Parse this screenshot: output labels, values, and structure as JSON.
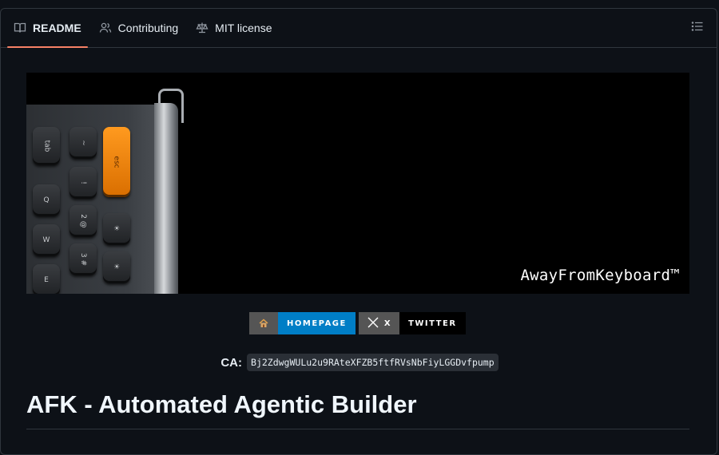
{
  "tabs": [
    {
      "label": "README",
      "icon": "book-icon",
      "active": true
    },
    {
      "label": "Contributing",
      "icon": "people-icon"
    },
    {
      "label": "MIT license",
      "icon": "law-scale-icon"
    }
  ],
  "outline_icon": "list-unordered-icon",
  "banner": {
    "wordmark": "AwayFromKeyboard™",
    "key_labels": [
      "tab",
      "~",
      "esc",
      "Q",
      "!",
      "2 @",
      "W",
      "3 #",
      "E"
    ]
  },
  "badges": {
    "homepage": {
      "icon": "house-emoji-icon",
      "label": "HOMEPAGE",
      "color": "#007ec6"
    },
    "twitter": {
      "icon": "x-logo-icon",
      "left_label": "X",
      "label": "TWITTER",
      "color": "#000000"
    }
  },
  "ca": {
    "label": "CA:",
    "address": "Bj2ZdwgWULu2u9RAteXFZB5ftfRVsNbFiyLGGDvfpump"
  },
  "heading": "AFK - Automated Agentic Builder",
  "colors": {
    "accent_underline": "#f78166",
    "background": "#0d1117",
    "border": "#30363d"
  }
}
